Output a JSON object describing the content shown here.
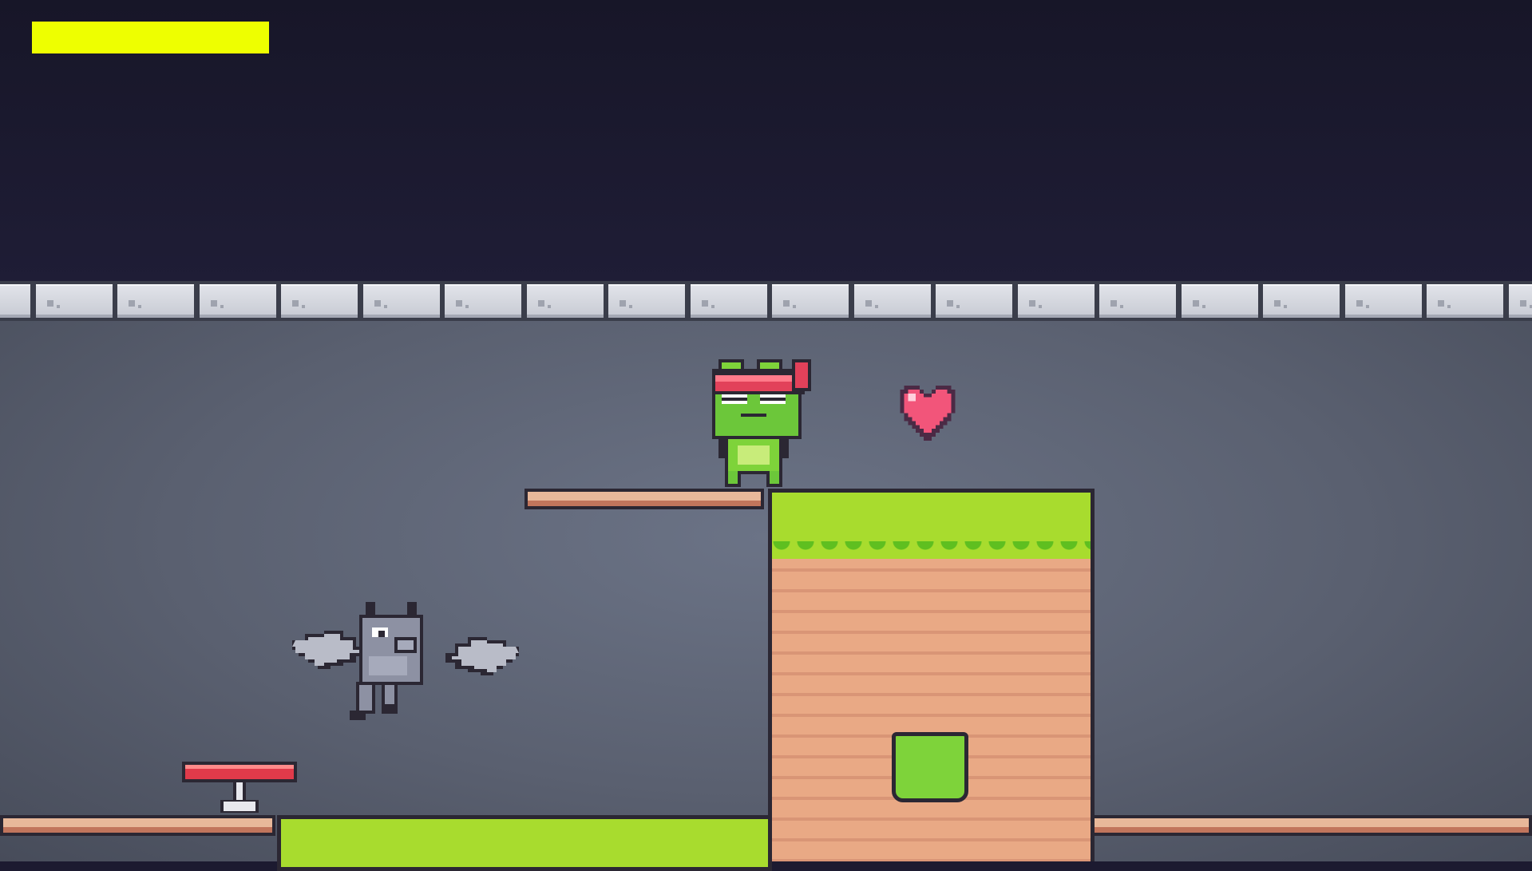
{
  "hud": {
    "health_fraction": 1.0,
    "health_color": "#eeff00"
  },
  "scene": {
    "player": {
      "sprite": "ninja-frog",
      "headband_color": "#e2415a"
    },
    "enemy": {
      "sprite": "gray-bat"
    },
    "pickup": {
      "sprite": "heart-icon",
      "color": "#f2557a"
    },
    "spring": {
      "sprite": "trampoline",
      "color": "#e03a4a"
    }
  }
}
